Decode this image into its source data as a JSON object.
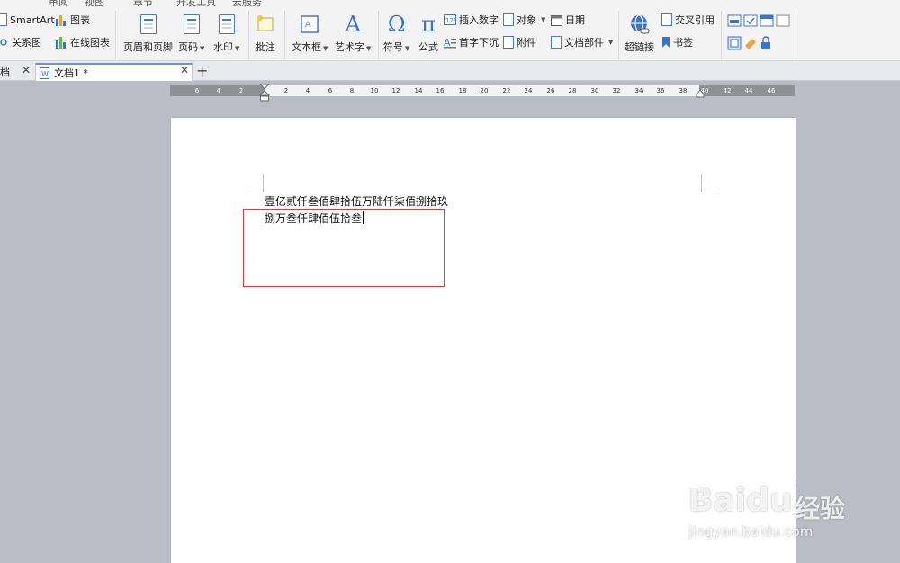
{
  "menu": {
    "items": [
      "审阅",
      "视图",
      "章节",
      "开发工具",
      "云服务"
    ]
  },
  "ribbon": {
    "smartart": "SmartArt",
    "chart": "图表",
    "relation": "关系图",
    "online_chart": "在线图表",
    "header_footer": "页眉和页脚",
    "page_number": "页码",
    "watermark": "水印",
    "comment": "批注",
    "textbox": "文本框",
    "wordart": "艺术字",
    "symbol": "符号",
    "formula": "公式",
    "insert_number": "插入数字",
    "dropcap": "首字下沉",
    "object": "对象",
    "attachment": "附件",
    "date": "日期",
    "doc_parts": "文档部件",
    "hyperlink": "超链接",
    "cross_ref": "交叉引用",
    "bookmark": "书签",
    "omega": "Ω",
    "pi": "π",
    "wordart_glyph": "A"
  },
  "tabs": [
    {
      "label": "档"
    },
    {
      "label": "文档1 *"
    }
  ],
  "ruler": {
    "left_ticks": [
      "6",
      "4",
      "2"
    ],
    "right_ticks": [
      "2",
      "4",
      "6",
      "8",
      "10",
      "12",
      "14",
      "16",
      "18",
      "20",
      "22",
      "24",
      "26",
      "28",
      "30",
      "32",
      "34",
      "36",
      "38",
      "40",
      "42",
      "44",
      "46"
    ]
  },
  "document": {
    "line1": "壹亿贰仟叁佰肆拾伍万陆仟柒佰捌拾玖",
    "line2": "捌万叁仟肆佰伍拾叁"
  },
  "watermark": {
    "brand": "Baidu",
    "suffix": "经验",
    "url": "jingyan.baidu.com"
  },
  "colors": {
    "accent": "#3d73c9",
    "highlight_border": "#e23a3a"
  }
}
